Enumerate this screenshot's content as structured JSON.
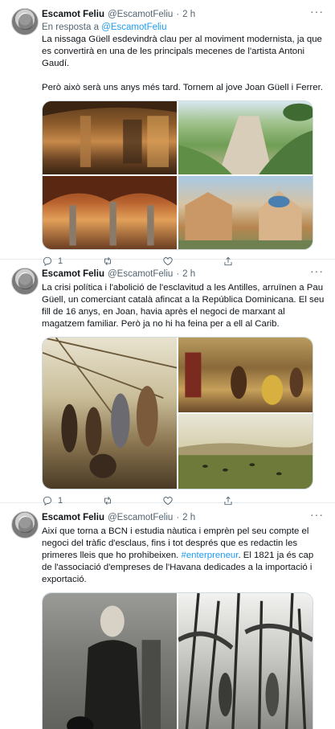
{
  "tweets": [
    {
      "name": "Escamot Feliu",
      "handle": "@EscamotFeliu",
      "dot": "·",
      "time": "2 h",
      "reply_prefix": "En resposta a",
      "reply_to": "@EscamotFeliu",
      "text": "La nissaga Güell esdevindrà clau per al moviment modernista, ja que es convertirà en una de les principals mecenes de l'artista Antoni Gaudí.\n\nPerò això serà uns anys més tard. Tornem al jove Joan Güell i Ferrer.",
      "replies": "1",
      "retweets": "",
      "likes": ""
    },
    {
      "name": "Escamot Feliu",
      "handle": "@EscamotFeliu",
      "dot": "·",
      "time": "2 h",
      "text": "La crisi política i l'abolició de l'esclavitud a les Antilles, arruïnen a Pau Güell, un comerciant català afincat a la República Dominicana. El seu fill de 16 anys, en Joan, havia après el negoci de marxant al magatzem familiar. Però ja no hi ha feina per a ell al Carib.",
      "replies": "1",
      "retweets": "",
      "likes": ""
    },
    {
      "name": "Escamot Feliu",
      "handle": "@EscamotFeliu",
      "dot": "·",
      "time": "2 h",
      "text_before": "Així que torna a BCN i estudia nàutica i emprèn pel seu compte el negoci del tràfic d'esclaus, fins i tot després que es redactin les primeres lleis que ho prohibeixen. ",
      "hashtag": "#enterpreneur",
      "text_after": ". El 1821 ja és cap de l'associació d'empreses de l'Havana dedicades a la importació i exportació."
    }
  ],
  "icons": {
    "more": "more-horizontal-icon",
    "reply": "reply-icon",
    "retweet": "retweet-icon",
    "like": "heart-icon",
    "share": "share-icon"
  },
  "colors": {
    "accent": "#1d9bf0",
    "secondary_text": "#536471",
    "border": "#cfd9de"
  }
}
